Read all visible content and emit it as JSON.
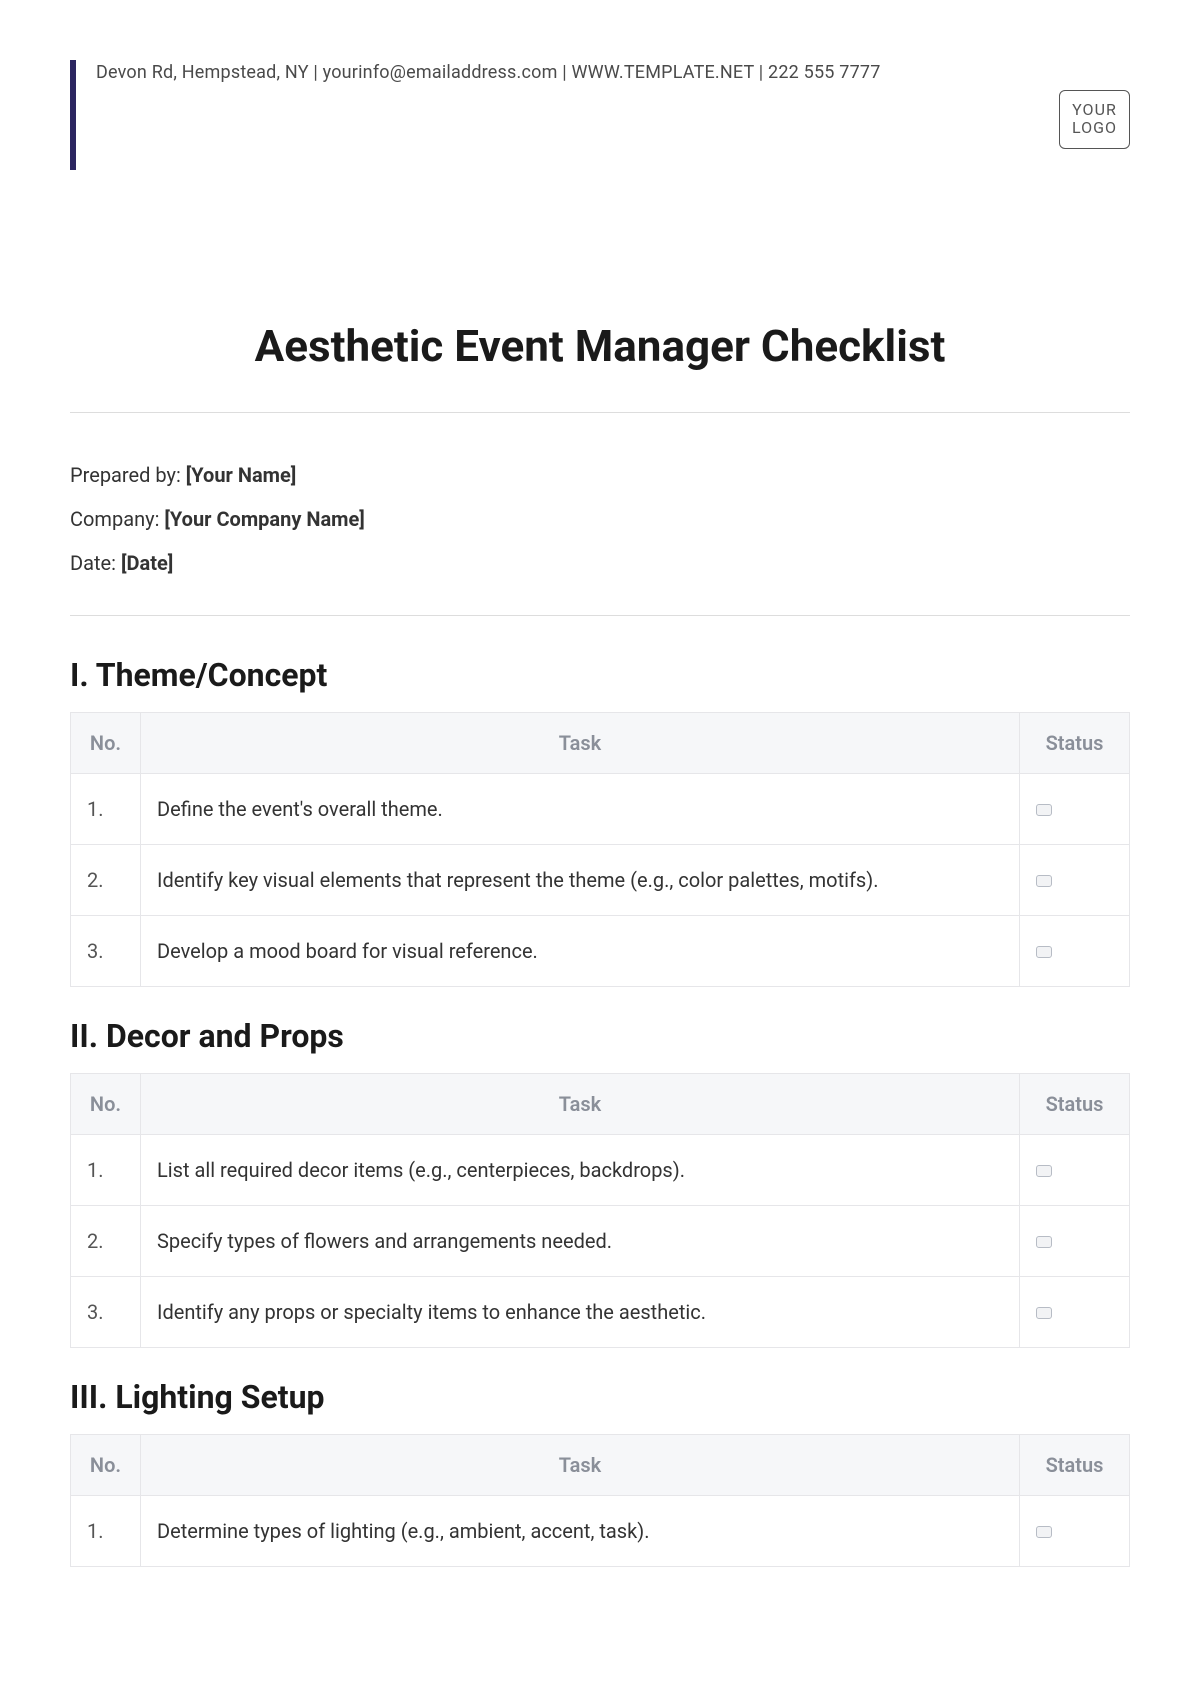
{
  "header": {
    "contact": "Devon Rd, Hempstead, NY | yourinfo@emailaddress.com | WWW.TEMPLATE.NET | 222 555 7777",
    "logo_line1": "YOUR",
    "logo_line2": "LOGO"
  },
  "title": "Aesthetic Event Manager Checklist",
  "meta": {
    "prepared_label": "Prepared by: ",
    "prepared_value": "[Your Name]",
    "company_label": "Company: ",
    "company_value": "[Your Company Name]",
    "date_label": "Date: ",
    "date_value": "[Date]"
  },
  "columns": {
    "no": "No.",
    "task": "Task",
    "status": "Status"
  },
  "sections": [
    {
      "heading": "I. Theme/Concept",
      "rows": [
        {
          "no": "1.",
          "task": "Define the event's overall theme."
        },
        {
          "no": "2.",
          "task": "Identify key visual elements that represent the theme (e.g., color palettes, motifs)."
        },
        {
          "no": "3.",
          "task": "Develop a mood board for visual reference."
        }
      ]
    },
    {
      "heading": "II. Decor and Props",
      "rows": [
        {
          "no": "1.",
          "task": "List all required decor items (e.g., centerpieces, backdrops)."
        },
        {
          "no": "2.",
          "task": "Specify types of flowers and arrangements needed."
        },
        {
          "no": "3.",
          "task": "Identify any props or specialty items to enhance the aesthetic."
        }
      ]
    },
    {
      "heading": "III. Lighting Setup",
      "rows": [
        {
          "no": "1.",
          "task": "Determine types of lighting (e.g., ambient, accent, task)."
        }
      ]
    }
  ]
}
